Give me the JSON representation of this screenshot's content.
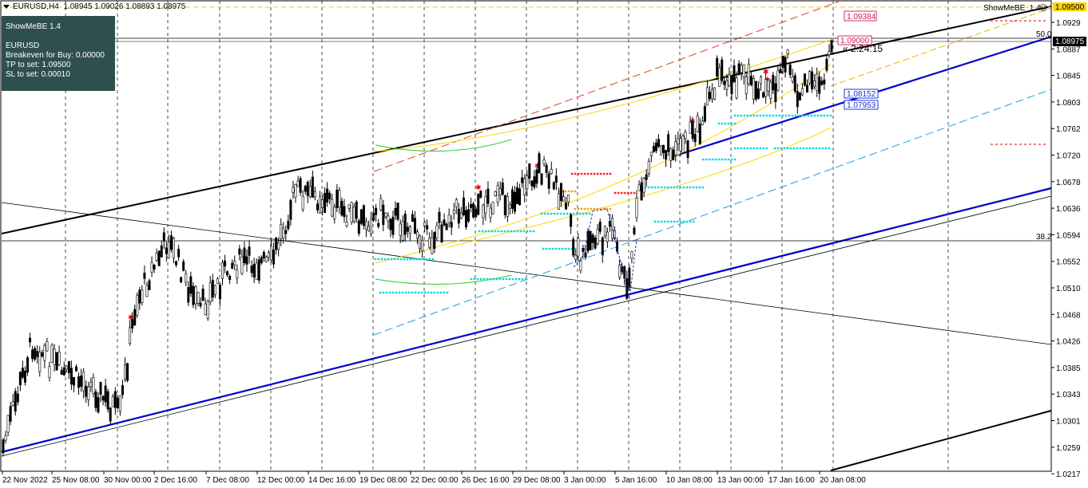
{
  "header": {
    "symbol_timeframe": "EURUSD,H4",
    "ohlc": "1.08945 1.09026 1.08893 1.08975"
  },
  "indicator_panel": {
    "title": "ShowMeBE 1.4",
    "symbol": "EURUSD",
    "breakeven": "Breakeven for Buy: 0.00000",
    "tp": "TP to set: 1.09500",
    "sl": "SL to set: 0.00010"
  },
  "indicator_label": "ShowMeBE_1.4",
  "smiley_icon": "smiley-icon",
  "countdown": "« 2:24:15",
  "colors": {
    "bull": "#000000",
    "bear": "#000000",
    "channel_blue": "#0000cc",
    "fib_yellow": "#ffd700",
    "cyan_dots": "#00e5ee",
    "red_marks": "#ff0000",
    "panel_bg": "#2f4f4f"
  },
  "price_axis": {
    "ticks": [
      "1.0929",
      "1.0887",
      "1.0845",
      "1.0803",
      "1.0762",
      "1.0720",
      "1.0678",
      "1.0636",
      "1.0594",
      "1.0552",
      "1.0510",
      "1.0468",
      "1.0426",
      "1.0385",
      "1.0343",
      "1.0301",
      "1.0259",
      "1.0217"
    ],
    "current_price": "1.08975",
    "box_labels": {
      "top_yellow": "1.09500",
      "red": "1.09384",
      "open_price": "1.09000",
      "blue1": "1.08152",
      "blue2": "1.07953"
    },
    "fib_50": "50.0",
    "fib_382": "38.2"
  },
  "time_axis": {
    "labels": [
      "22 Nov 2022",
      "25 Nov 08:00",
      "30 Nov 00:00",
      "2 Dec 16:00",
      "7 Dec 08:00",
      "12 Dec 00:00",
      "14 Dec 16:00",
      "19 Dec 08:00",
      "22 Dec 00:00",
      "26 Dec 16:00",
      "29 Dec 08:00",
      "3 Jan 00:00",
      "5 Jan 16:00",
      "10 Jan 08:00",
      "13 Jan 00:00",
      "17 Jan 16:00",
      "20 Jan 08:00"
    ]
  }
}
